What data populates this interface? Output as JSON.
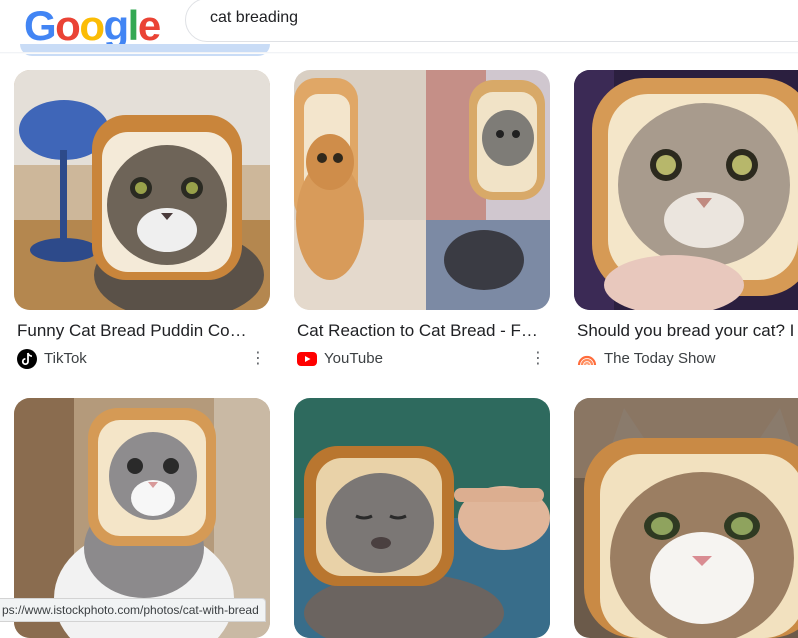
{
  "logo": {
    "letters": [
      "G",
      "o",
      "o",
      "g",
      "l",
      "e"
    ],
    "colors": [
      "#4285F4",
      "#EA4335",
      "#FBBC05",
      "#4285F4",
      "#34A853",
      "#EA4335"
    ]
  },
  "search": {
    "query": "cat breading"
  },
  "results": [
    {
      "title": "Funny Cat Bread Puddin Co…",
      "source": "TikTok",
      "source_icon": "tiktok-icon"
    },
    {
      "title": "Cat Reaction to Cat Bread - F…",
      "source": "YouTube",
      "source_icon": "youtube-icon"
    },
    {
      "title": "Should you bread your cat? I",
      "source": "The Today Show",
      "source_icon": "today-show-icon"
    }
  ],
  "status_url": "ps://www.istockphoto.com/photos/cat-with-bread",
  "colors": {
    "youtube_red": "#FF0000",
    "today_orange": "#FF6C3B",
    "status_bg": "#f1f3f4"
  }
}
